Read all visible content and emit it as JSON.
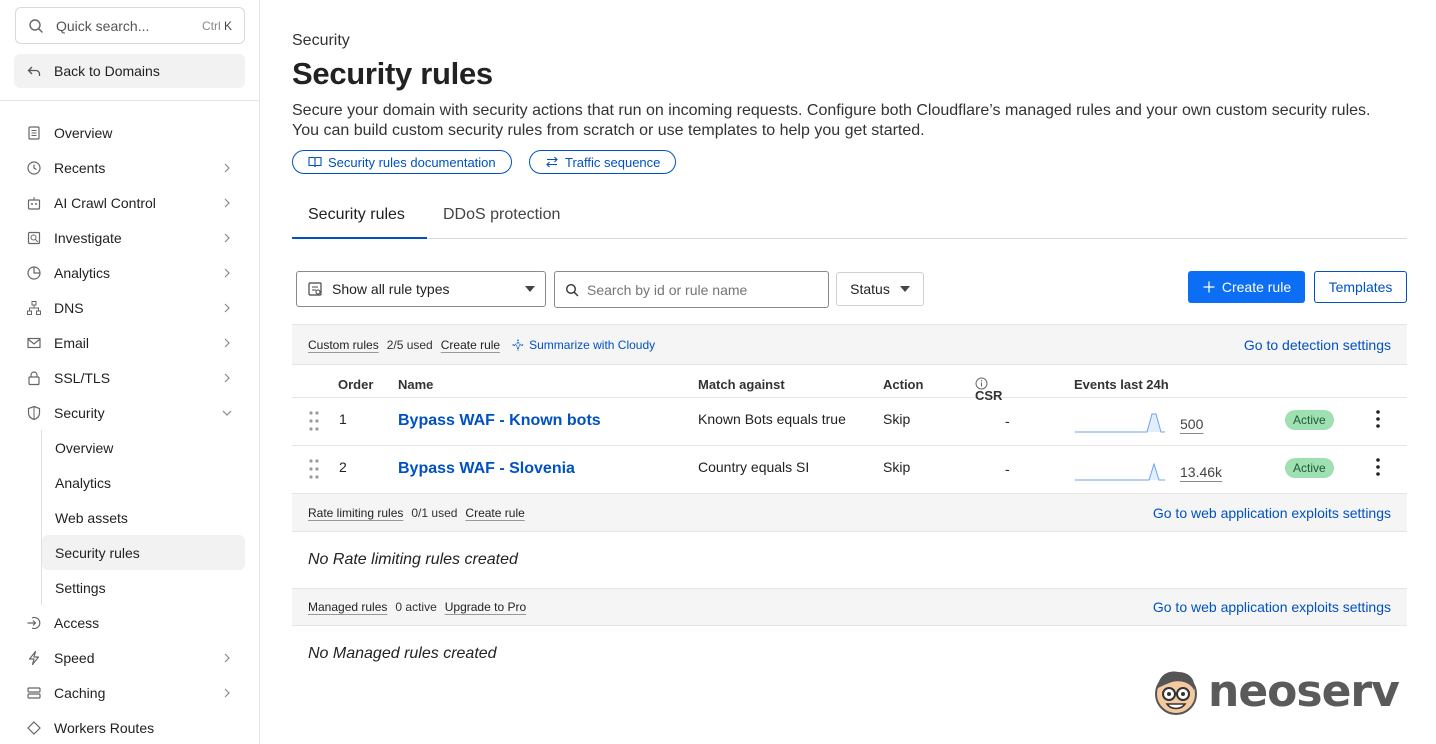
{
  "sidebar": {
    "quick_search": {
      "placeholder": "Quick search...",
      "shortcut_mod": "Ctrl",
      "shortcut_key": "K"
    },
    "back_label": "Back to Domains",
    "items": [
      {
        "label": "Overview",
        "icon": "document-icon",
        "chevron": false
      },
      {
        "label": "Recents",
        "icon": "clock-icon",
        "chevron": true
      },
      {
        "label": "AI Crawl Control",
        "icon": "robot-icon",
        "chevron": true
      },
      {
        "label": "Investigate",
        "icon": "investigate-icon",
        "chevron": true
      },
      {
        "label": "Analytics",
        "icon": "pie-chart-icon",
        "chevron": true
      },
      {
        "label": "DNS",
        "icon": "network-icon",
        "chevron": true
      },
      {
        "label": "Email",
        "icon": "mail-icon",
        "chevron": true
      },
      {
        "label": "SSL/TLS",
        "icon": "lock-icon",
        "chevron": true
      },
      {
        "label": "Security",
        "icon": "shield-icon",
        "chevron": "down"
      }
    ],
    "security_sub": [
      {
        "label": "Overview"
      },
      {
        "label": "Analytics"
      },
      {
        "label": "Web assets"
      },
      {
        "label": "Security rules",
        "active": true
      },
      {
        "label": "Settings"
      }
    ],
    "items_after": [
      {
        "label": "Access",
        "icon": "login-icon",
        "chevron": false
      },
      {
        "label": "Speed",
        "icon": "lightning-icon",
        "chevron": true
      },
      {
        "label": "Caching",
        "icon": "database-icon",
        "chevron": true
      },
      {
        "label": "Workers Routes",
        "icon": "diamond-icon",
        "chevron": false
      }
    ]
  },
  "header": {
    "eyebrow": "Security",
    "title": "Security rules",
    "description": "Secure your domain with security actions that run on incoming requests. Configure both Cloudflare’s managed rules and your own custom security rules. You can build custom security rules from scratch or use templates to help you get started.",
    "doc_link": "Security rules documentation",
    "traffic_link": "Traffic sequence"
  },
  "tabs": [
    "Security rules",
    "DDoS protection"
  ],
  "toolbar": {
    "rule_type_select": "Show all rule types",
    "search_placeholder": "Search by id or rule name",
    "status_label": "Status",
    "create_label": "Create rule",
    "templates_label": "Templates"
  },
  "custom_rules": {
    "name": "Custom rules",
    "used": "2/5 used",
    "create": "Create rule",
    "cloudy": "Summarize with Cloudy",
    "right_link": "Go to detection settings",
    "columns": [
      "Order",
      "Name",
      "Match against",
      "Action",
      "CSR",
      "Events last 24h"
    ],
    "rows": [
      {
        "order": "1",
        "name": "Bypass WAF - Known bots",
        "match": "Known Bots equals true",
        "action": "Skip",
        "csr": "-",
        "events": "500",
        "status": "Active"
      },
      {
        "order": "2",
        "name": "Bypass WAF - Slovenia",
        "match": "Country equals SI",
        "action": "Skip",
        "csr": "-",
        "events": "13.46k",
        "status": "Active"
      }
    ]
  },
  "rate_limiting": {
    "name": "Rate limiting rules",
    "used": "0/1 used",
    "create": "Create rule",
    "right_link": "Go to web application exploits settings",
    "empty": "No Rate limiting rules created"
  },
  "managed": {
    "name": "Managed rules",
    "used": "0 active",
    "upgrade": "Upgrade to Pro",
    "right_link": "Go to web application exploits settings",
    "empty": "No Managed rules created"
  },
  "watermark": {
    "text": "neoserv"
  },
  "colors": {
    "accent": "#0051c3",
    "primary_button": "#0b6ef5",
    "active_badge": "#9fe0b3"
  }
}
